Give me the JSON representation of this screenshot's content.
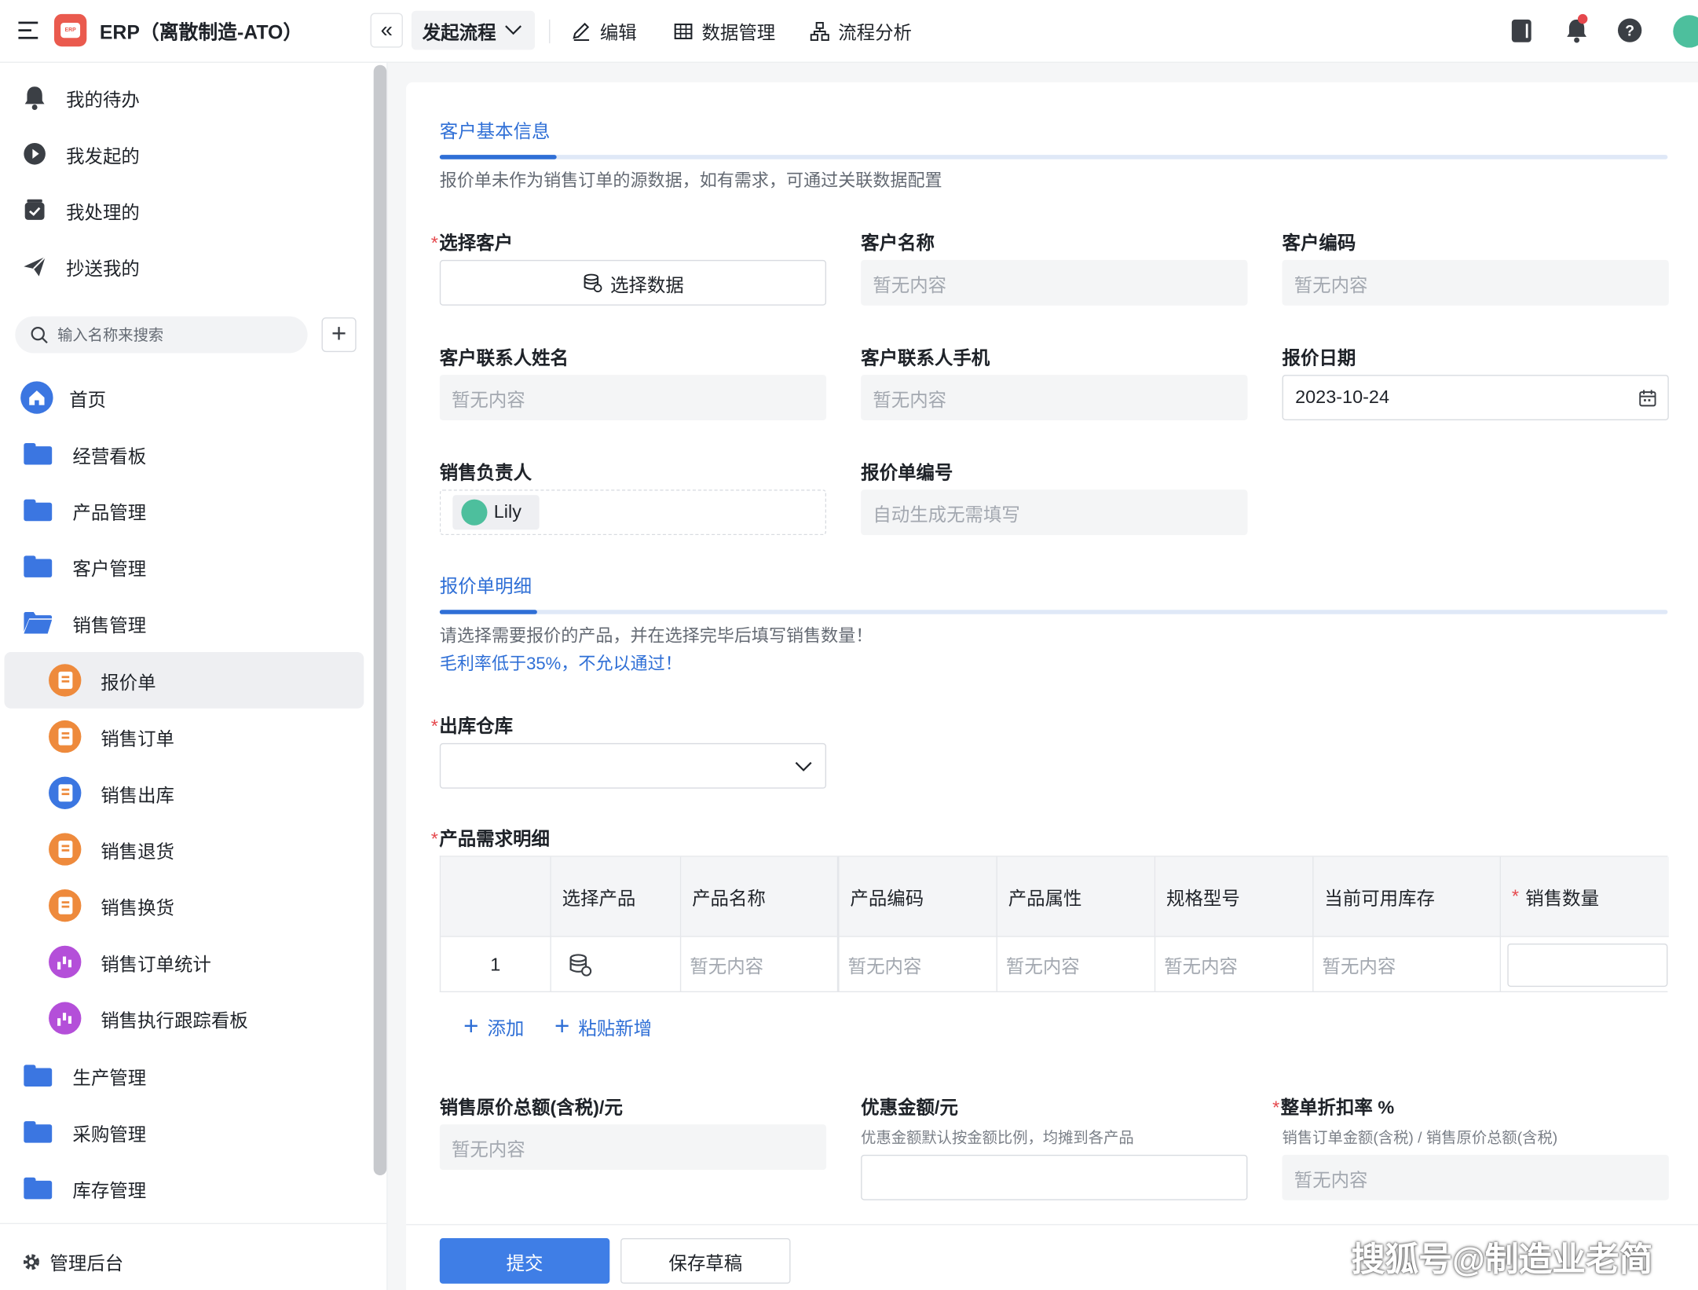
{
  "app": {
    "title": "ERP（离散制造-ATO）",
    "logo_text": "ERP"
  },
  "toolbar": {
    "launch_label": "发起流程",
    "edit_label": "编辑",
    "data_mgmt_label": "数据管理",
    "flow_analysis_label": "流程分析"
  },
  "sidebar": {
    "quick": [
      {
        "label": "我的待办",
        "icon": "bell-icon"
      },
      {
        "label": "我发起的",
        "icon": "play-circle-icon"
      },
      {
        "label": "我处理的",
        "icon": "check-box-icon"
      },
      {
        "label": "抄送我的",
        "icon": "paper-plane-icon"
      }
    ],
    "search_placeholder": "输入名称来搜索",
    "nav": [
      {
        "label": "首页",
        "icon": "home-icon"
      },
      {
        "label": "经营看板",
        "icon": "folder-icon"
      },
      {
        "label": "产品管理",
        "icon": "folder-icon"
      },
      {
        "label": "客户管理",
        "icon": "folder-icon"
      },
      {
        "label": "销售管理",
        "icon": "folder-open-icon"
      },
      {
        "label": "报价单",
        "icon": "doc-icon",
        "active": true
      },
      {
        "label": "销售订单",
        "icon": "doc-icon"
      },
      {
        "label": "销售出库",
        "icon": "doc-icon"
      },
      {
        "label": "销售退货",
        "icon": "doc-icon"
      },
      {
        "label": "销售换货",
        "icon": "doc-icon"
      },
      {
        "label": "销售订单统计",
        "icon": "bar-chart-icon"
      },
      {
        "label": "销售执行跟踪看板",
        "icon": "bar-chart-icon"
      },
      {
        "label": "生产管理",
        "icon": "folder-icon"
      },
      {
        "label": "采购管理",
        "icon": "folder-icon"
      },
      {
        "label": "库存管理",
        "icon": "folder-icon"
      }
    ],
    "admin_label": "管理后台"
  },
  "form": {
    "section1": {
      "title": "客户基本信息",
      "note": "报价单未作为销售订单的源数据，如有需求，可通过关联数据配置"
    },
    "select_customer": {
      "label": "选择客户",
      "button": "选择数据"
    },
    "customer_name": {
      "label": "客户名称",
      "value": "暂无内容"
    },
    "customer_code": {
      "label": "客户编码",
      "value": "暂无内容"
    },
    "contact_name": {
      "label": "客户联系人姓名",
      "value": "暂无内容"
    },
    "contact_phone": {
      "label": "客户联系人手机",
      "value": "暂无内容"
    },
    "quote_date": {
      "label": "报价日期",
      "value": "2023-10-24"
    },
    "sales_owner": {
      "label": "销售负责人",
      "value": "Lily"
    },
    "quote_no": {
      "label": "报价单编号",
      "value": "自动生成无需填写"
    },
    "section2": {
      "title": "报价单明细",
      "note": "请选择需要报价的产品，并在选择完毕后填写销售数量！",
      "warning": "毛利率低于35%，不允以通过！"
    },
    "warehouse": {
      "label": "出库仓库",
      "value": ""
    },
    "details": {
      "label": "产品需求明细",
      "columns": [
        "选择产品",
        "产品名称",
        "产品编码",
        "产品属性",
        "规格型号",
        "当前可用库存",
        "销售数量"
      ],
      "rows": [
        {
          "index": "1",
          "name": "暂无内容",
          "code": "暂无内容",
          "attr": "暂无内容",
          "spec": "暂无内容",
          "stock": "暂无内容"
        }
      ],
      "add_label": "添加",
      "paste_label": "粘贴新增"
    },
    "total": {
      "label": "销售原价总额(含税)/元",
      "value": "暂无内容"
    },
    "discount_amount": {
      "label": "优惠金额/元",
      "hint": "优惠金额默认按金额比例，均摊到各产品",
      "value": ""
    },
    "discount_rate": {
      "label": "整单折扣率 %",
      "hint": "销售订单金额(含税) / 销售原价总额(含税)",
      "value": "暂无内容"
    },
    "submit_label": "提交",
    "draft_label": "保存草稿"
  },
  "watermark": "搜狐号@制造业老简",
  "colors": {
    "accent": "#2f6fd6",
    "primary_button": "#3f7ee6",
    "required": "#e5484d",
    "logo": "#ea5a4e"
  }
}
